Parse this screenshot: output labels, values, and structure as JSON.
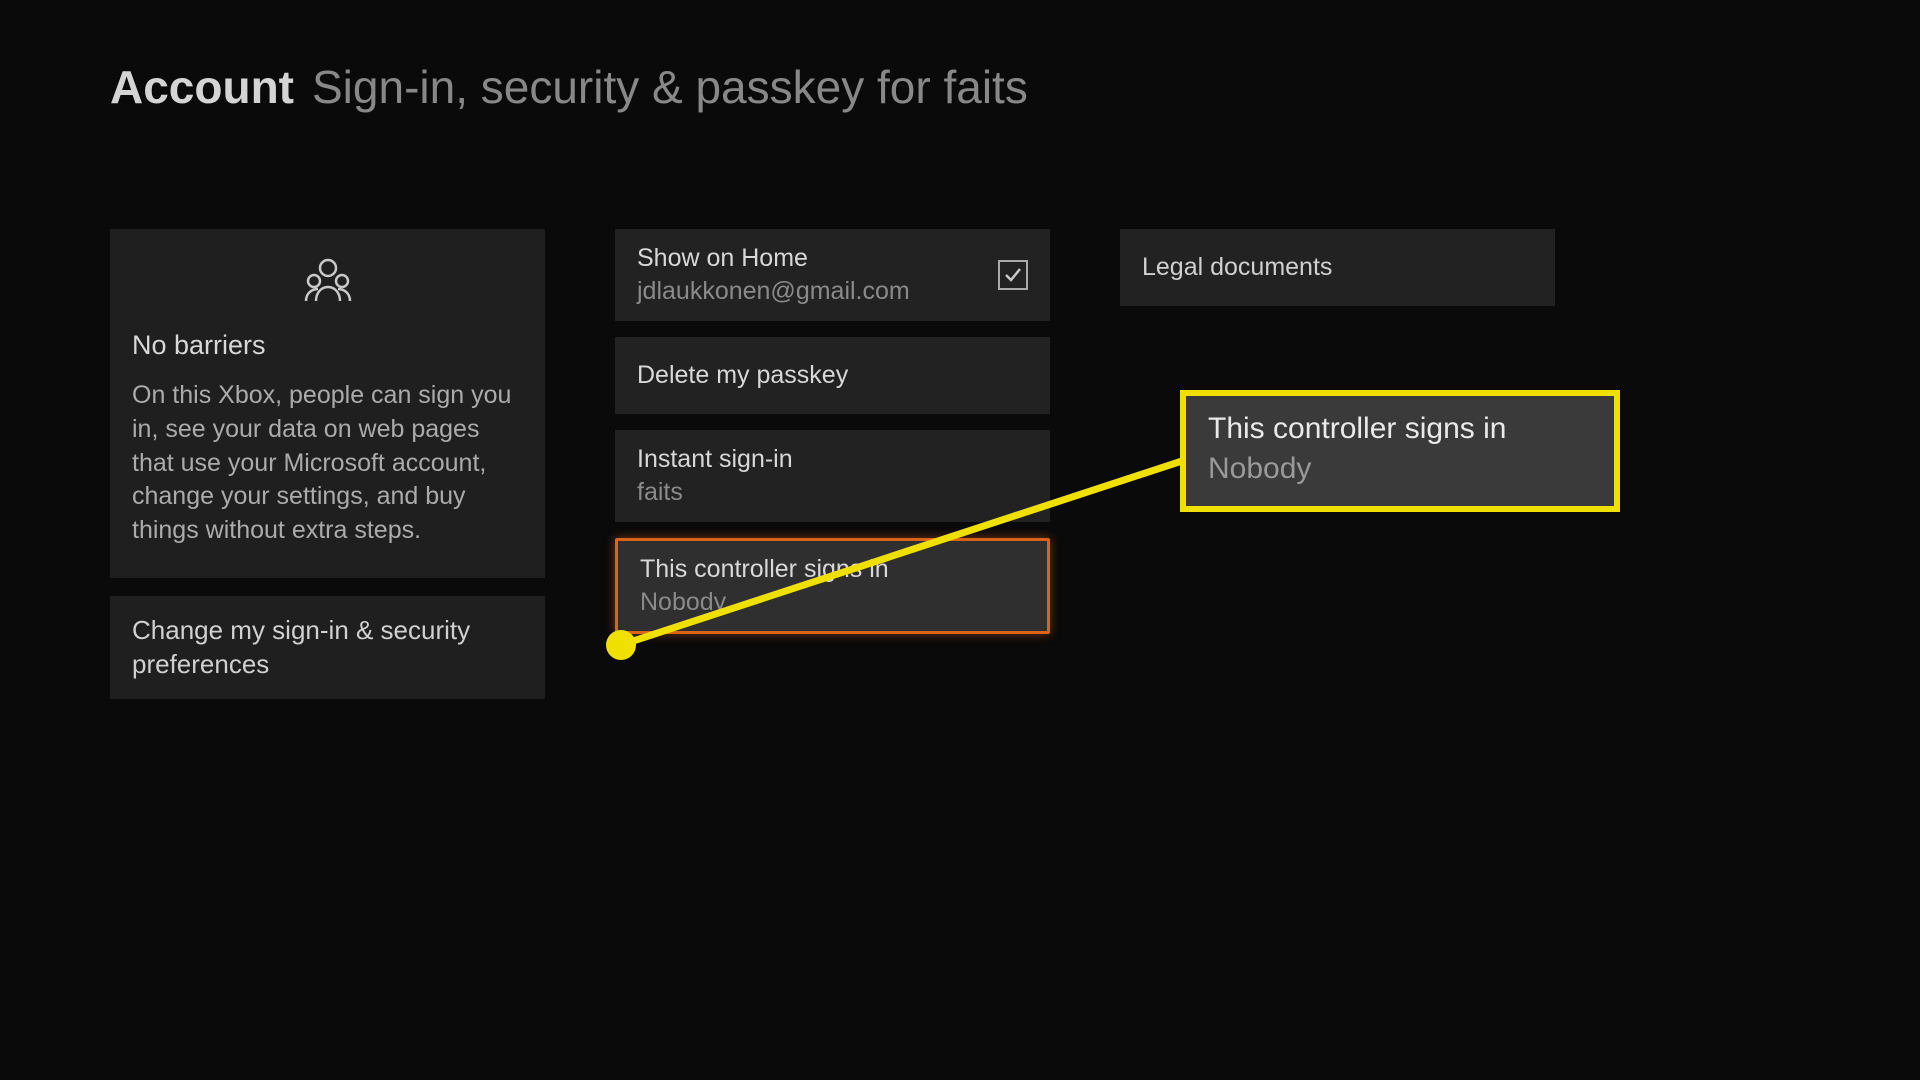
{
  "header": {
    "section": "Account",
    "subtitle": "Sign-in, security & passkey for faits"
  },
  "info": {
    "title": "No barriers",
    "body": "On this Xbox, people can sign you in, see your data on web pages that use your Microsoft account, change your settings, and buy things without extra steps."
  },
  "preferences": {
    "label": "Change my sign-in & security preferences"
  },
  "showOnHome": {
    "title": "Show on Home",
    "sub": "jdlaukkonen@gmail.com",
    "checked": true
  },
  "deletePasskey": {
    "title": "Delete my passkey"
  },
  "instantSignIn": {
    "title": "Instant sign-in",
    "sub": "faits"
  },
  "controllerSignsIn": {
    "title": "This controller signs in",
    "sub": "Nobody"
  },
  "legal": {
    "title": "Legal documents"
  },
  "callout": {
    "title": "This controller signs in",
    "sub": "Nobody"
  }
}
